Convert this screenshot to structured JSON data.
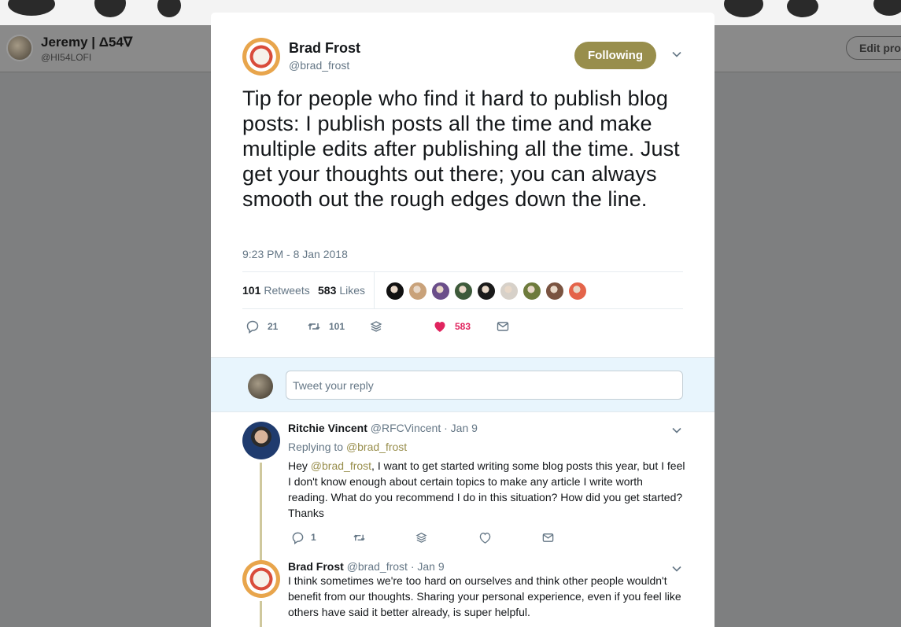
{
  "background_profile": {
    "name": "Jeremy | Δ54∇",
    "handle": "@HI54LOFI",
    "edit_label": "Edit pro"
  },
  "tweet": {
    "author_name": "Brad Frost",
    "author_handle": "@brad_frost",
    "follow_label": "Following",
    "text": "Tip for people who find it hard to publish blog posts: I publish posts all the time and make multiple edits after publishing all the time. Just get your thoughts out there; you can always smooth out the rough edges down the line.",
    "timestamp": "9:23 PM - 8 Jan 2018",
    "retweets_count": "101",
    "retweets_label": "Retweets",
    "likes_count": "583",
    "likes_label": "Likes",
    "likers": [
      {
        "color": "#111111"
      },
      {
        "color": "#c9a27a"
      },
      {
        "color": "#6b4e8a"
      },
      {
        "color": "#3d5a3a"
      },
      {
        "color": "#1a1a1a"
      },
      {
        "color": "#d7d1c9"
      },
      {
        "color": "#6e7b3c"
      },
      {
        "color": "#7a5340"
      },
      {
        "color": "#e4644a"
      }
    ],
    "actions": {
      "reply_count": "21",
      "retweet_count": "101",
      "like_count": "583"
    },
    "icons": {
      "reply": "reply-icon",
      "retweet": "retweet-icon",
      "stack": "layers-icon",
      "like": "heart-filled-icon",
      "dm": "envelope-icon"
    }
  },
  "reply_box": {
    "placeholder": "Tweet your reply"
  },
  "replies": [
    {
      "name": "Ritchie Vincent",
      "handle": "@RFCVincent",
      "date": "· Jan 9",
      "replying_prefix": "Replying to",
      "replying_to": "@brad_frost",
      "text_prefix": "Hey",
      "text_mention": "@brad_frost",
      "text_rest": ", I want to get started writing some blog posts this year, but I feel I don't know enough about certain topics to make any article I write worth reading. What do you recommend I do in this situation? How did you get started? Thanks",
      "reply_count": "1"
    },
    {
      "name": "Brad Frost",
      "handle": "@brad_frost",
      "date": "· Jan 9",
      "text": "I think sometimes we're too hard on ourselves and think other people wouldn't benefit from our thoughts. Sharing your personal experience, even if you feel like others have said it better already, is super helpful."
    }
  ],
  "colors": {
    "accent": "#988e4c",
    "like": "#e0245e",
    "muted_text": "#657786",
    "overlay": "#7e7f80"
  }
}
